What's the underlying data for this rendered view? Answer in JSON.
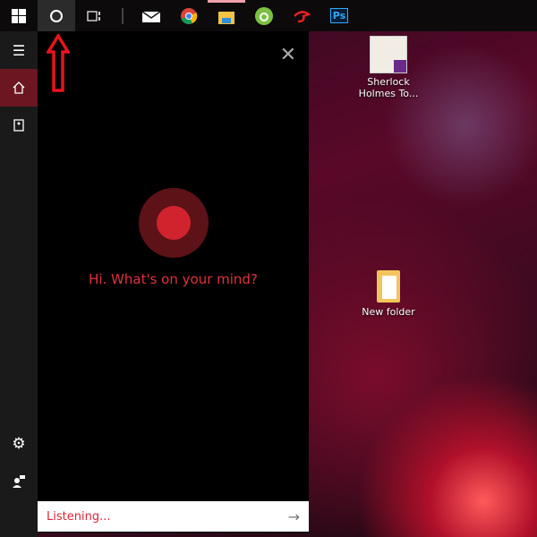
{
  "taskbar": {
    "items": [
      "start-button",
      "cortana-button",
      "task-view-button",
      "mail",
      "chrome",
      "file-explorer",
      "coc-coc",
      "garena",
      "photoshop"
    ],
    "photoshop_label": "Ps"
  },
  "cortana": {
    "greeting": "Hi. What's on your mind?",
    "status": "Listening...",
    "accent": "#e0313c"
  },
  "sidebar": {
    "items": [
      "menu",
      "home",
      "notebook",
      "settings",
      "feedback"
    ]
  },
  "desktop": {
    "icons": [
      {
        "label": "Sherlock Holmes To..."
      },
      {
        "label": "New folder"
      }
    ]
  }
}
